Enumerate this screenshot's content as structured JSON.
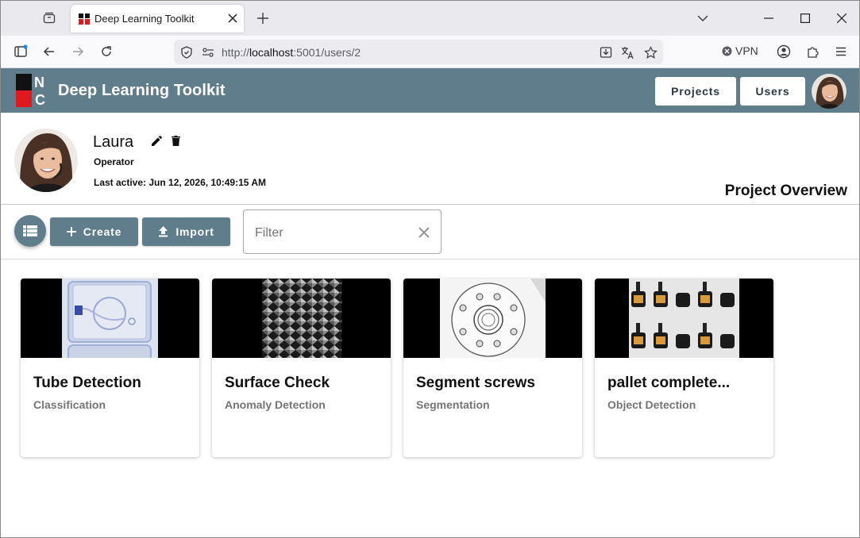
{
  "browser": {
    "tab_title": "Deep Learning Toolkit",
    "url_prefix": "http://",
    "url_host": "localhost",
    "url_rest": ":5001/users/2",
    "vpn_label": "VPN"
  },
  "app": {
    "title": "Deep Learning Toolkit",
    "logo_letters": [
      "N",
      "C"
    ],
    "nav": {
      "projects_label": "Projects",
      "users_label": "Users"
    }
  },
  "profile": {
    "name": "Laura",
    "role": "Operator",
    "last_active": "Last active: Jun 12, 2026, 10:49:15 AM"
  },
  "overview": {
    "title": "Project Overview",
    "create_label": "Create",
    "import_label": "Import",
    "filter_placeholder": "Filter",
    "filter_value": ""
  },
  "projects": [
    {
      "title": "Tube Detection",
      "type": "Classification"
    },
    {
      "title": "Surface Check",
      "type": "Anomaly Detection"
    },
    {
      "title": "Segment screws",
      "type": "Segmentation"
    },
    {
      "title": "pallet complete...",
      "type": "Object Detection"
    }
  ],
  "colors": {
    "header": "#5f7d8b",
    "logo_red": "#e0191f",
    "button_text": "#2c3940"
  },
  "icons": [
    "tab-overview-icon",
    "close-icon",
    "plus-icon",
    "chevron-down-icon",
    "minimize-icon",
    "maximize-icon",
    "sidebar-icon",
    "back-icon",
    "forward-icon",
    "reload-icon",
    "shield-icon",
    "permissions-icon",
    "download-icon",
    "translate-icon",
    "star-icon",
    "account-icon",
    "extensions-icon",
    "menu-icon",
    "pencil-icon",
    "trash-icon",
    "list-view-icon",
    "upload-icon"
  ]
}
